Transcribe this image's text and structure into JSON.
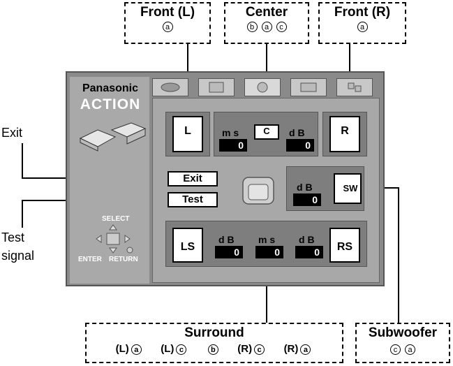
{
  "callouts": {
    "front_l": {
      "title": "Front (L)",
      "marks": [
        "a"
      ]
    },
    "center": {
      "title": "Center",
      "marks": [
        "b",
        "a",
        "c"
      ]
    },
    "front_r": {
      "title": "Front (R)",
      "marks": [
        "a"
      ]
    },
    "surround": {
      "title": "Surround",
      "items": [
        {
          "prefix": "(L)",
          "mark": "a"
        },
        {
          "prefix": "(L)",
          "mark": "c"
        },
        {
          "prefix": "",
          "mark": "b"
        },
        {
          "prefix": "(R)",
          "mark": "c"
        },
        {
          "prefix": "(R)",
          "mark": "a"
        }
      ]
    },
    "subwoofer": {
      "title": "Subwoofer",
      "marks": [
        "c",
        "a"
      ]
    }
  },
  "side_labels": {
    "exit": "Exit",
    "test_line1": "Test",
    "test_line2": "signal"
  },
  "panel": {
    "brand": "Panasonic",
    "product": "ACTION",
    "nav": {
      "select": "SELECT",
      "enter": "ENTER",
      "return": "RETURN"
    },
    "front_left": "L",
    "front_right": "R",
    "center": {
      "speaker": "C",
      "delay_unit": "m s",
      "delay_value": "0",
      "level_unit": "d B",
      "level_value": "0"
    },
    "subwoofer": {
      "speaker": "SW",
      "level_unit": "d B",
      "level_value": "0"
    },
    "surround": {
      "left_speaker": "LS",
      "right_speaker": "RS",
      "left_level_unit": "d B",
      "left_level_value": "0",
      "delay_unit": "m s",
      "delay_value": "0",
      "right_level_unit": "d B",
      "right_level_value": "0"
    },
    "exit_button": "Exit",
    "test_button": "Test"
  }
}
